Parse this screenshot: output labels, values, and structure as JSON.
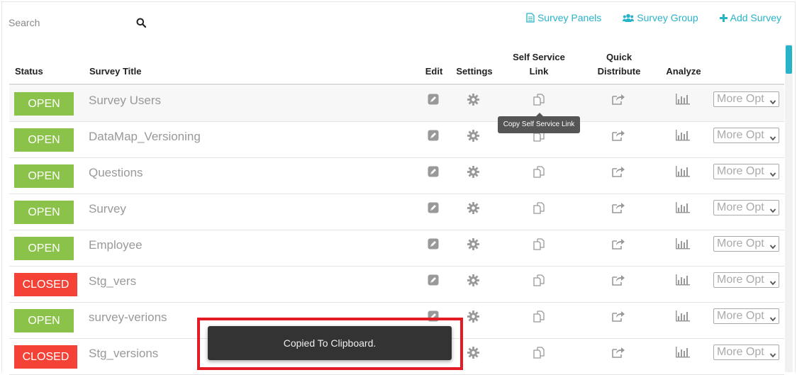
{
  "search": {
    "placeholder": "Search"
  },
  "top_links": {
    "survey_panels": "Survey Panels",
    "survey_group": "Survey Group",
    "add_survey": "Add Survey"
  },
  "headers": {
    "status": "Status",
    "survey_title": "Survey Title",
    "edit": "Edit",
    "settings": "Settings",
    "self_service_line1": "Self Service",
    "self_service_line2": "Link",
    "quick_line1": "Quick",
    "quick_line2": "Distribute",
    "analyze": "Analyze"
  },
  "rows": [
    {
      "status": "OPEN",
      "title": "Survey Users",
      "more": "More Opt"
    },
    {
      "status": "OPEN",
      "title": "DataMap_Versioning",
      "more": "More Opt"
    },
    {
      "status": "OPEN",
      "title": "Questions",
      "more": "More Opt"
    },
    {
      "status": "OPEN",
      "title": "Survey",
      "more": "More Opt"
    },
    {
      "status": "OPEN",
      "title": "Employee",
      "more": "More Opt"
    },
    {
      "status": "CLOSED",
      "title": "Stg_vers",
      "more": "More Opt"
    },
    {
      "status": "OPEN",
      "title": "survey-verions",
      "more": "More Opt"
    },
    {
      "status": "CLOSED",
      "title": "Stg_versions",
      "more": "More Opt"
    }
  ],
  "tooltip": "Copy Self Service Link",
  "toast": "Copied To Clipboard.",
  "colors": {
    "accent": "#29b3c9",
    "open": "#8bc34a",
    "closed": "#f44336",
    "highlight": "#e21b24"
  },
  "icons": [
    "search-icon",
    "file-text-icon",
    "users-icon",
    "plus-icon",
    "pencil-square-icon",
    "gear-icon",
    "copy-icon",
    "share-icon",
    "bar-chart-icon",
    "chevron-down-icon"
  ]
}
